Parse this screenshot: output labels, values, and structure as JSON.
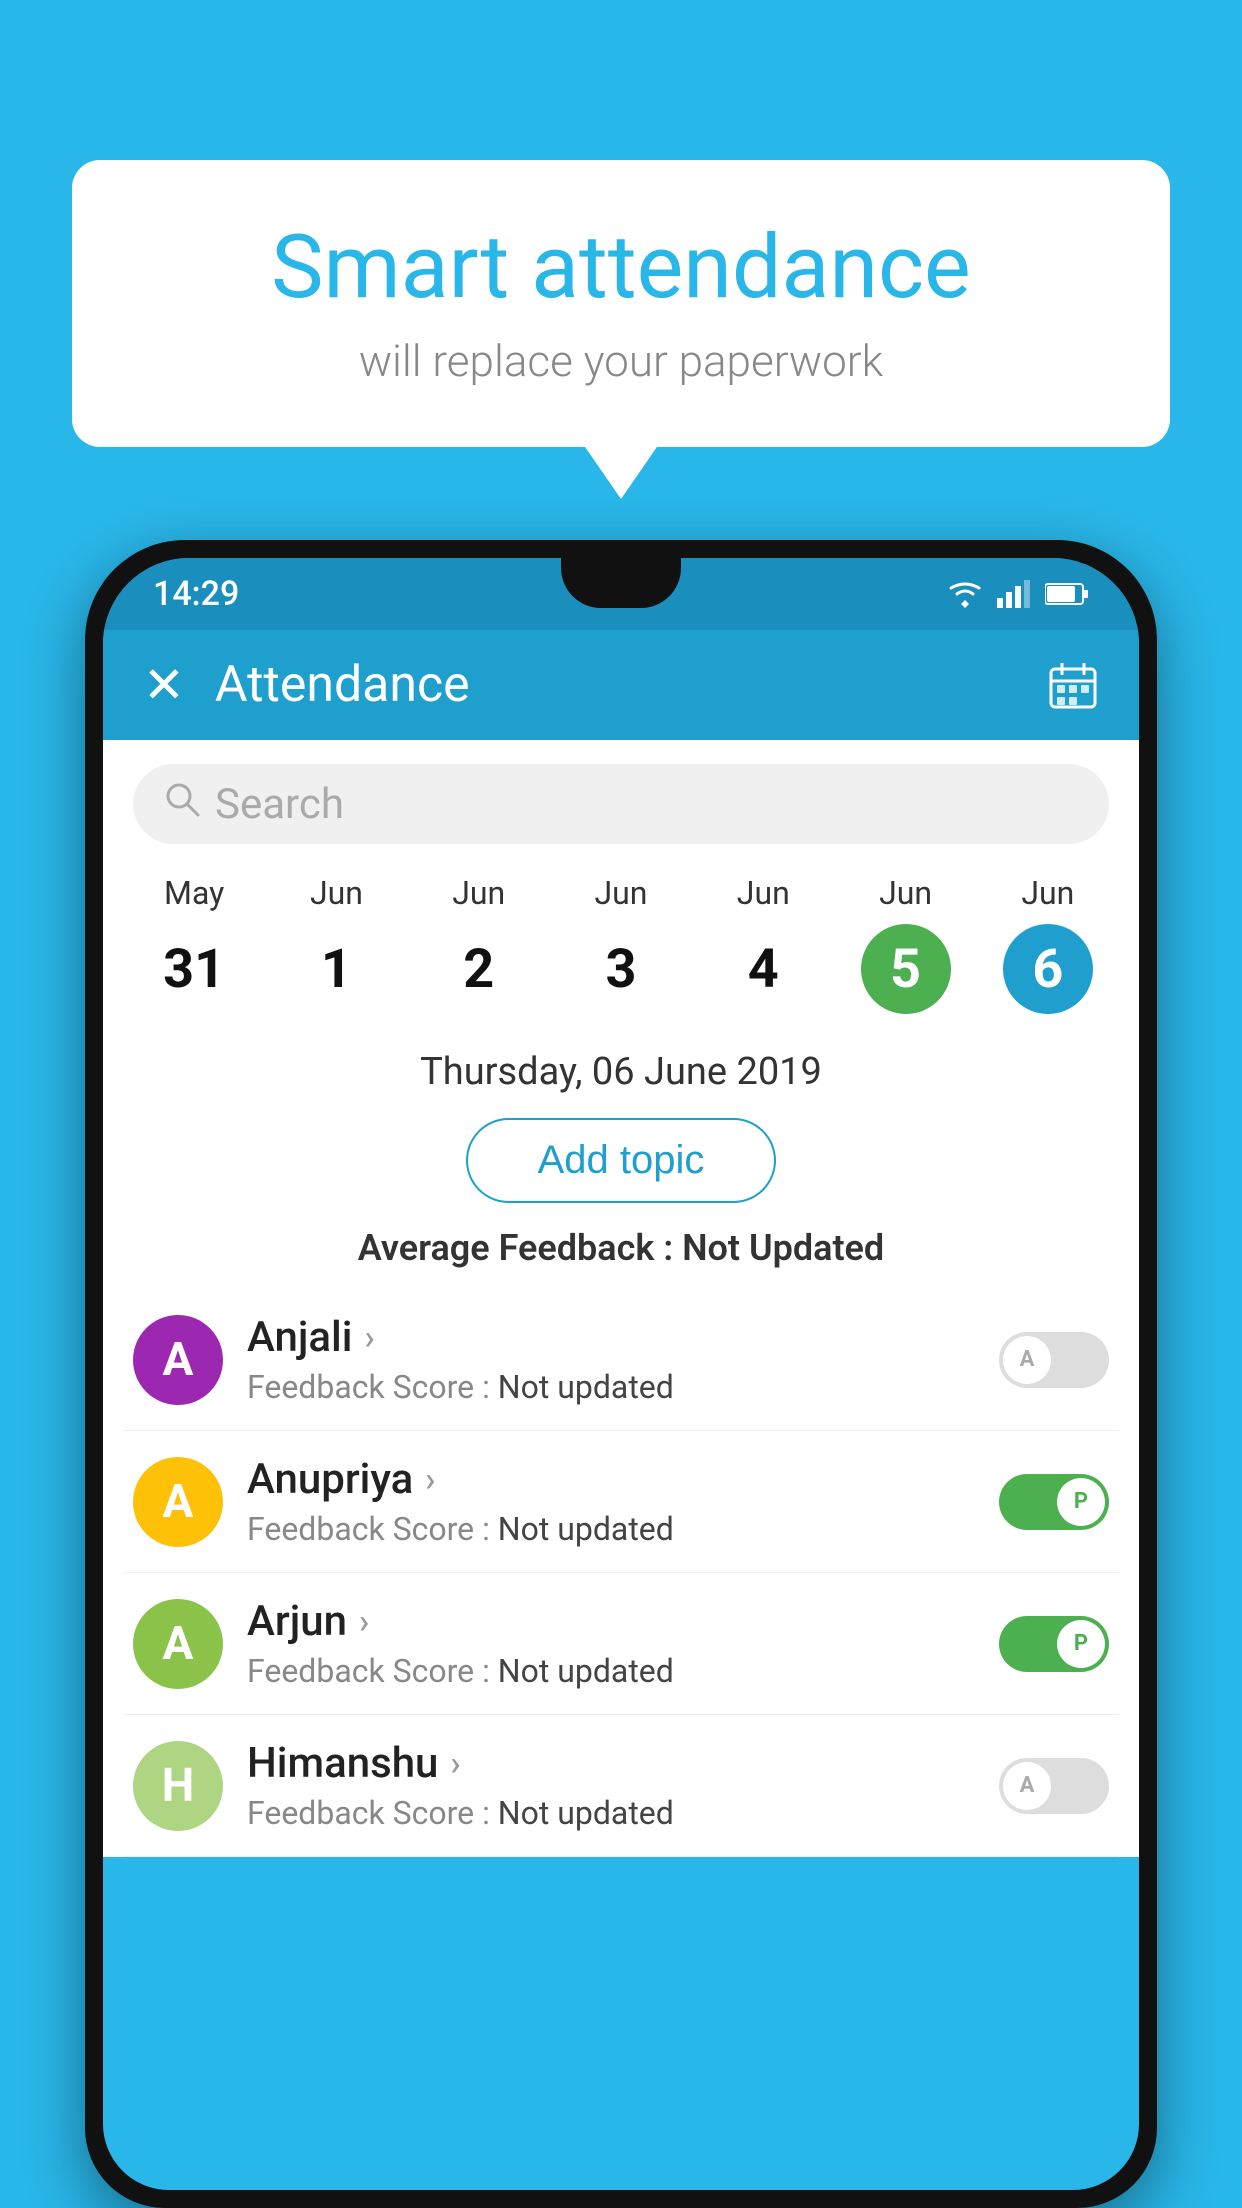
{
  "background_color": "#29b6e8",
  "bubble": {
    "title": "Smart attendance",
    "subtitle": "will replace your paperwork"
  },
  "phone": {
    "status_bar": {
      "time": "14:29",
      "icons": [
        "wifi",
        "signal",
        "battery"
      ]
    },
    "app_bar": {
      "title": "Attendance",
      "close_label": "✕",
      "calendar_icon": "📅"
    },
    "search": {
      "placeholder": "Search"
    },
    "calendar": {
      "days": [
        {
          "month": "May",
          "num": "31",
          "state": "normal"
        },
        {
          "month": "Jun",
          "num": "1",
          "state": "normal"
        },
        {
          "month": "Jun",
          "num": "2",
          "state": "normal"
        },
        {
          "month": "Jun",
          "num": "3",
          "state": "normal"
        },
        {
          "month": "Jun",
          "num": "4",
          "state": "normal"
        },
        {
          "month": "Jun",
          "num": "5",
          "state": "today"
        },
        {
          "month": "Jun",
          "num": "6",
          "state": "selected"
        }
      ]
    },
    "selected_date": "Thursday, 06 June 2019",
    "add_topic_label": "Add topic",
    "avg_feedback_label": "Average Feedback :",
    "avg_feedback_value": "Not Updated",
    "students": [
      {
        "name": "Anjali",
        "avatar_letter": "A",
        "avatar_color": "#9c27b0",
        "feedback_label": "Feedback Score :",
        "feedback_value": "Not updated",
        "attendance": "absent"
      },
      {
        "name": "Anupriya",
        "avatar_letter": "A",
        "avatar_color": "#ffc107",
        "feedback_label": "Feedback Score :",
        "feedback_value": "Not updated",
        "attendance": "present"
      },
      {
        "name": "Arjun",
        "avatar_letter": "A",
        "avatar_color": "#8bc34a",
        "feedback_label": "Feedback Score :",
        "feedback_value": "Not updated",
        "attendance": "present"
      },
      {
        "name": "Himanshu",
        "avatar_letter": "H",
        "avatar_color": "#aed581",
        "feedback_label": "Feedback Score :",
        "feedback_value": "Not updated",
        "attendance": "absent"
      }
    ],
    "toggle_labels": {
      "absent": "A",
      "present": "P"
    }
  }
}
